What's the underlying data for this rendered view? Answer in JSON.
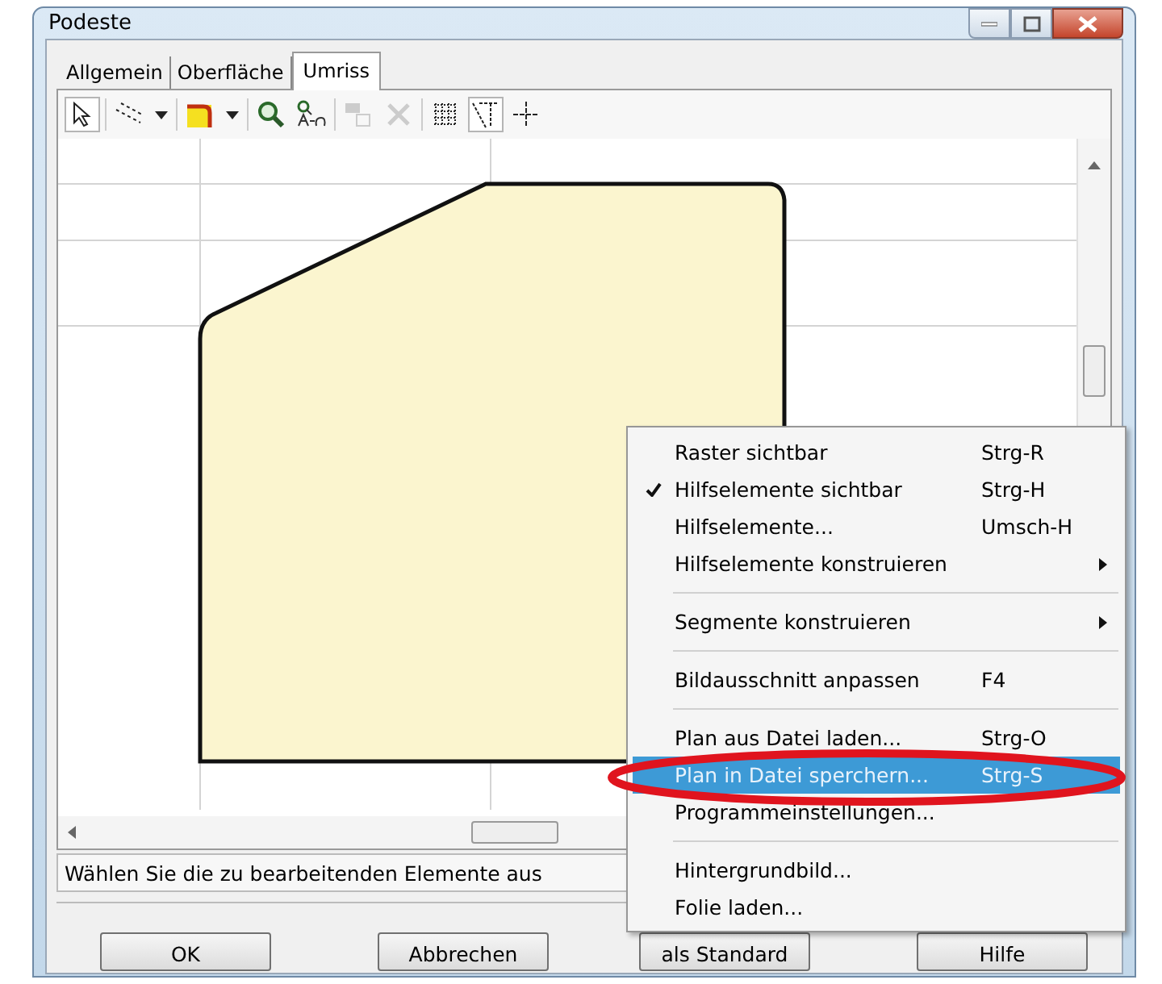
{
  "window": {
    "title": "Podeste"
  },
  "tabs": [
    {
      "label": "Allgemein",
      "selected": false
    },
    {
      "label": "Oberfläche",
      "selected": false
    },
    {
      "label": "Umriss",
      "selected": true
    }
  ],
  "toolbar": [
    {
      "kind": "pointer",
      "selected": true,
      "disabled": false
    },
    {
      "kind": "line",
      "selected": false,
      "disabled": false
    },
    {
      "kind": "dropdown",
      "selected": false,
      "disabled": false
    },
    {
      "kind": "corner",
      "selected": false,
      "disabled": false
    },
    {
      "kind": "dropdown",
      "selected": false,
      "disabled": false
    },
    {
      "kind": "zoom",
      "selected": false,
      "disabled": false
    },
    {
      "kind": "measure",
      "selected": false,
      "disabled": false
    },
    {
      "kind": "copy",
      "selected": false,
      "disabled": true
    },
    {
      "kind": "delete",
      "selected": false,
      "disabled": true
    },
    {
      "kind": "grid",
      "selected": false,
      "disabled": false
    },
    {
      "kind": "guides",
      "selected": true,
      "disabled": false
    },
    {
      "kind": "cross",
      "selected": false,
      "disabled": false
    }
  ],
  "context_menu": [
    {
      "kind": "item",
      "label": "Raster sichtbar",
      "shortcut": "Strg-R",
      "checked": false,
      "submenu": false,
      "selected": false
    },
    {
      "kind": "item",
      "label": "Hilfselemente sichtbar",
      "shortcut": "Strg-H",
      "checked": true,
      "submenu": false,
      "selected": false
    },
    {
      "kind": "item",
      "label": "Hilfselemente...",
      "shortcut": "Umsch-H",
      "checked": false,
      "submenu": false,
      "selected": false
    },
    {
      "kind": "item",
      "label": "Hilfselemente konstruieren",
      "checked": false,
      "submenu": true,
      "selected": false
    },
    {
      "kind": "separator"
    },
    {
      "kind": "item",
      "label": "Segmente konstruieren",
      "checked": false,
      "submenu": true,
      "selected": false
    },
    {
      "kind": "separator"
    },
    {
      "kind": "item",
      "label": "Bildausschnitt anpassen",
      "shortcut": "F4",
      "checked": false,
      "submenu": false,
      "selected": false
    },
    {
      "kind": "separator"
    },
    {
      "kind": "item",
      "label": "Plan aus Datei laden...",
      "shortcut": "Strg-O",
      "checked": false,
      "submenu": false,
      "selected": false
    },
    {
      "kind": "item",
      "label": "Plan in Datei sperchern...",
      "shortcut": "Strg-S",
      "checked": false,
      "submenu": false,
      "selected": true
    },
    {
      "kind": "item",
      "label": "Programmeinstellungen...",
      "checked": false,
      "submenu": false,
      "selected": false
    },
    {
      "kind": "separator"
    },
    {
      "kind": "item",
      "label": "Hintergrundbild...",
      "checked": false,
      "submenu": false,
      "selected": false
    },
    {
      "kind": "item",
      "label": "Folie laden...",
      "checked": false,
      "submenu": false,
      "selected": false
    }
  ],
  "status_bar": {
    "text": "Wählen Sie die zu bearbeitenden Elemente aus"
  },
  "buttons": [
    {
      "label": "OK"
    },
    {
      "label": "Abbrechen"
    },
    {
      "label": "als Standard"
    },
    {
      "label": "Hilfe"
    }
  ]
}
